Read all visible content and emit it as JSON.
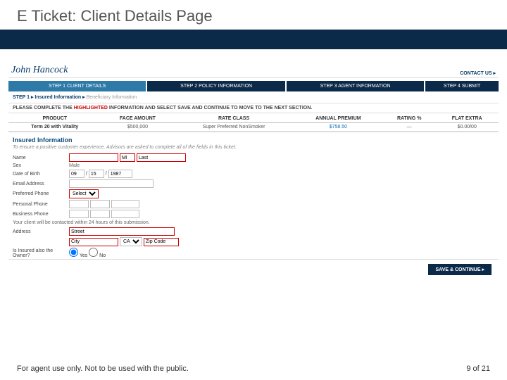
{
  "slide": {
    "title": "E Ticket: Client Details Page",
    "disclaimer": "For agent use only. Not to be used with the public.",
    "page_current": "9",
    "page_sep": " of ",
    "page_total": "21"
  },
  "topbar": {
    "logo_text": "John Hancock",
    "contact_label": "CONTACT US ▸"
  },
  "steps": [
    {
      "label": "STEP 1  CLIENT DETAILS"
    },
    {
      "label": "STEP 2  POLICY INFORMATION"
    },
    {
      "label": "STEP 3  AGENT INFORMATION"
    },
    {
      "label": "STEP 4  SUBMIT"
    }
  ],
  "breadcrumb": {
    "step": "STEP 1",
    "section": "Insured Information",
    "current": "Beneficiary Information"
  },
  "instruction": {
    "prefix": "PLEASE COMPLETE THE ",
    "highlight": "HIGHLIGHTED",
    "suffix": " INFORMATION AND SELECT SAVE AND CONTINUE TO MOVE TO THE NEXT SECTION."
  },
  "summary": {
    "headers": [
      "PRODUCT",
      "FACE AMOUNT",
      "RATE CLASS",
      "ANNUAL PREMIUM",
      "RATING %",
      "FLAT EXTRA"
    ],
    "values": [
      "Term 20 with Vitality",
      "$500,000",
      "Super Preferred NonSmoker",
      "$758.50",
      "—",
      "$0.00/00"
    ]
  },
  "section": {
    "heading": "Insured Information",
    "subtext": "To ensure a positive customer experience, Advisors are asked to complete all of the fields in this ticket."
  },
  "form": {
    "name_label": "Name",
    "name_first_value": "",
    "name_mi_value": "MI",
    "name_last_value": "Last",
    "sex_label": "Sex",
    "sex_value": "Male",
    "dob_label": "Date of Birth",
    "dob_m": "09",
    "dob_d": "15",
    "dob_y": "1987",
    "email_label": "Email Address",
    "email_value": "",
    "pref_label": "Preferred Phone",
    "pref_select": "Select",
    "personal_label": "Personal Phone",
    "business_label": "Business Phone",
    "contact_note": "Your client will be contacted within 24 hours of this submission.",
    "address_label": "Address",
    "street_value": "Street",
    "city_value": "City",
    "state_value": "CA",
    "zip_value": "Zip Code",
    "owner_label": "Is Insured also the Owner?",
    "owner_yes": "Yes",
    "owner_no": "No"
  },
  "actions": {
    "save_continue": "SAVE & CONTINUE ▸"
  }
}
